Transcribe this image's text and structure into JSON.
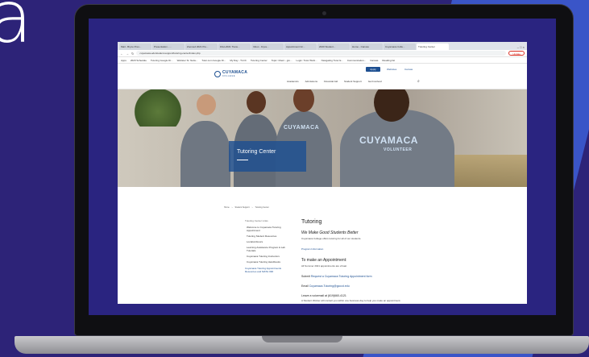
{
  "video": {
    "overlay_letter": "a"
  },
  "browser": {
    "tabs": [
      "Mail - Bryce Pres...",
      "Presentation - ...",
      "Zoomed 2021 Pre...",
      "FALL2021 Trans...",
      "Inbox - bryce...",
      "Appointment for...",
      "2020 Student...",
      "Home - Canvas",
      "Cuyamaca Colle...",
      "Tutoring Center"
    ],
    "window_controls": "–  □  ×",
    "nav": {
      "back": "←",
      "forward": "→",
      "reload": "↻"
    },
    "url": "cuyamaca.edu/student-support/tutoring-center/index.php",
    "update_label": "Update",
    "bookmarks": [
      "Apps",
      "2020 Schedule",
      "Tutoring Google Dr...",
      "Webster Sr. Netw...",
      "Tutor.com Google Dr...",
      "My Day - TLCC",
      "Tutoring Center",
      "Topic: Client - gro...",
      "Login: Tutor Work...",
      "Navigating Tutor E...",
      "Communication...",
      "Canvas",
      "Reading list"
    ]
  },
  "site": {
    "logo_name": "CUYAMACA",
    "logo_sub": "COLLEGE",
    "apply_label": "Apply",
    "utility_links": [
      "Websites",
      "Canvas"
    ],
    "main_nav": [
      "Academics",
      "Admissions",
      "Financial Aid",
      "Student Support",
      "Get Involved"
    ],
    "search_icon": "⌕"
  },
  "hero": {
    "title": "Tutoring Center",
    "shirt_text_1": "CUYAMACA",
    "shirt_text_2": "CUYAMACA",
    "shirt_sub": "VOLUNTEER"
  },
  "breadcrumb": [
    "Home",
    "Student Support",
    "Tutoring Center"
  ],
  "sidebar": {
    "heading": "Tutoring Center Links",
    "items": [
      "Welcome to Cuyamaca Tutoring Appointment",
      "Tutoring Student Resources",
      "Location/Hours",
      "Learning Assistance Program & Lab Tutorials",
      "Cuyamaca Tutoring Instructors",
      "Cuyamaca Tutoring Handbooks"
    ],
    "footer": "Cuyamaca Tutoring Appointments Resources and MATH 090"
  },
  "content": {
    "title": "Tutoring",
    "subtitle": "We Make Good Students Better",
    "subtitle_small": "Cuyamaca College offers tutoring for all of our students.",
    "link": "Program Information",
    "appointment_heading": "To make an Appointment:",
    "appointment_note": "All Summer 2021 appointments are virtual.",
    "submit_prefix": "Submit",
    "submit_link": "Request a Cuyamaca Tutoring Appointment form",
    "email_prefix": "Email",
    "email_link": "Cuyamaca.Tutoring@gcccd.edu",
    "voicemail": "Leave a voicemail at (619)660-4121",
    "bottom_note": "A Student Worker will contact you within one business day to help you make an appointment."
  }
}
